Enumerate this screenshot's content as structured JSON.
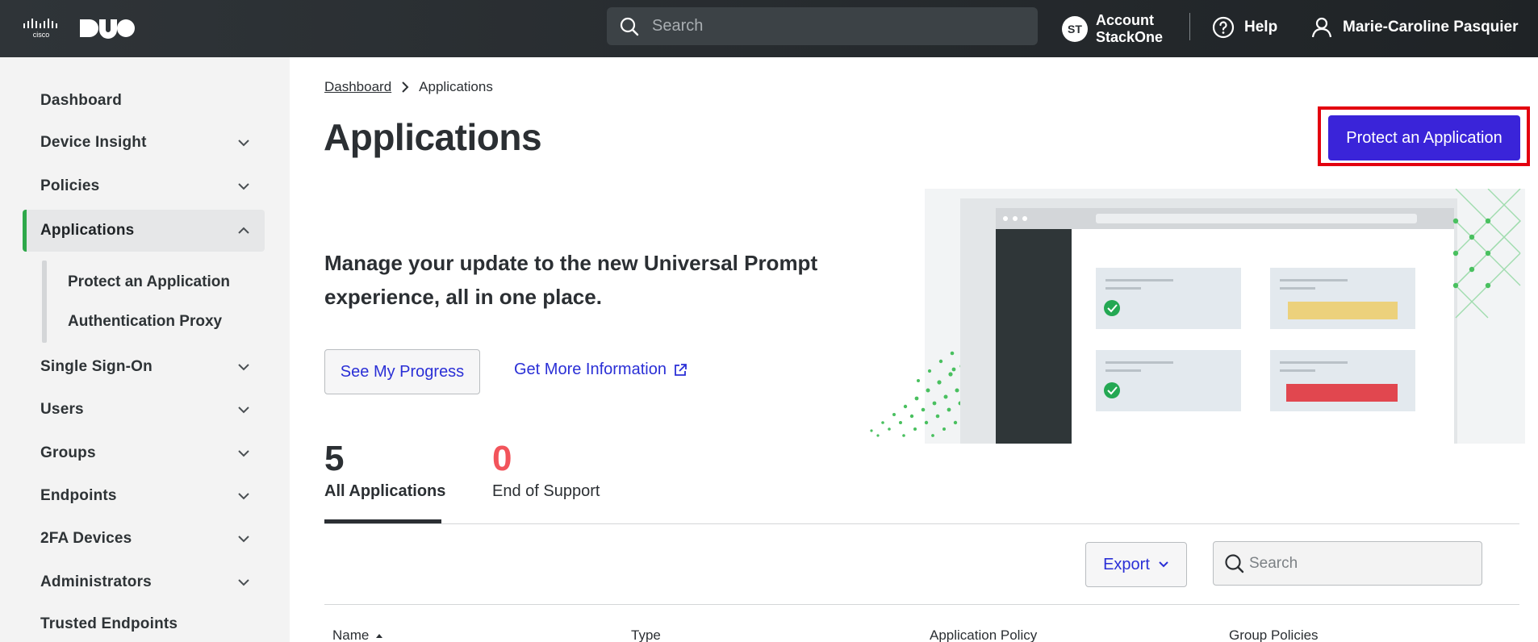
{
  "header": {
    "brand_cisco": "cisco",
    "brand_duo": "DUO",
    "search_placeholder": "Search",
    "account_initials": "ST",
    "account_line1": "Account",
    "account_line2": "StackOne",
    "help_label": "Help",
    "user_name": "Marie-Caroline Pasquier"
  },
  "sidebar": {
    "items": [
      {
        "label": "Dashboard",
        "has_chevron": false
      },
      {
        "label": "Device Insight",
        "has_chevron": true
      },
      {
        "label": "Policies",
        "has_chevron": true
      },
      {
        "label": "Applications",
        "has_chevron": true,
        "expanded": true,
        "active": true
      },
      {
        "label": "Single Sign-On",
        "has_chevron": true
      },
      {
        "label": "Users",
        "has_chevron": true
      },
      {
        "label": "Groups",
        "has_chevron": true
      },
      {
        "label": "Endpoints",
        "has_chevron": true
      },
      {
        "label": "2FA Devices",
        "has_chevron": true
      },
      {
        "label": "Administrators",
        "has_chevron": true
      },
      {
        "label": "Trusted Endpoints",
        "has_chevron": false
      }
    ],
    "subitems": [
      {
        "label": "Protect an Application"
      },
      {
        "label": "Authentication Proxy"
      }
    ],
    "active_accent": "#2ea84a"
  },
  "breadcrumb": {
    "root": "Dashboard",
    "current": "Applications"
  },
  "page": {
    "title": "Applications",
    "protect_button": "Protect an Application",
    "accent": "#3a24d9"
  },
  "promo": {
    "heading": "Manage your update to the new Universal Prompt experience, all in one place.",
    "progress_button": "See My Progress",
    "more_info_link": "Get More Information"
  },
  "tabs": [
    {
      "count": "5",
      "label": "All Applications",
      "selected": true
    },
    {
      "count": "0",
      "label": "End of Support",
      "selected": false,
      "count_color": "#f2545b"
    }
  ],
  "toolbar": {
    "export_label": "Export",
    "search_placeholder": "Search"
  },
  "table": {
    "columns": [
      "Name",
      "Type",
      "Application Policy",
      "Group Policies"
    ],
    "sort_column": "Name",
    "sort_direction": "ascending"
  }
}
